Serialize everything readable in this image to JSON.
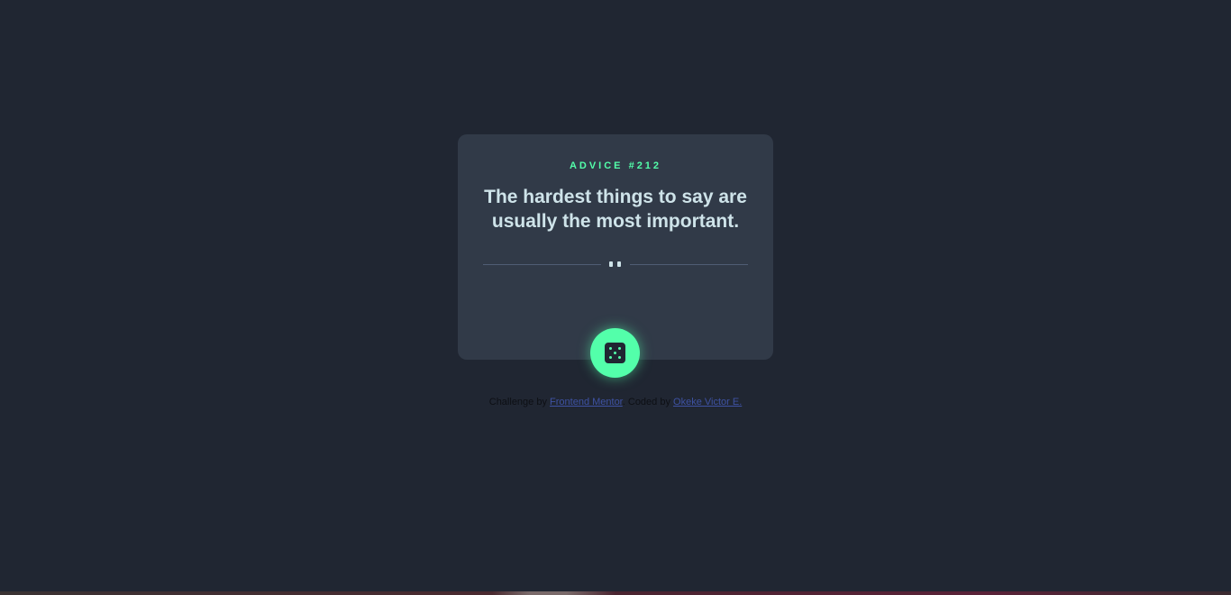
{
  "card": {
    "advice_label": "ADVICE #212",
    "advice_text": "The hardest things to say are usually the most important."
  },
  "divider": {
    "icon": "pause-icon"
  },
  "dice_button": {
    "icon": "dice-icon"
  },
  "attribution": {
    "challenge_prefix": "Challenge by",
    "challenge_link": "Frontend Mentor",
    "separator": ".",
    "coded_prefix": "Coded by",
    "coded_link": "Okeke Victor E."
  },
  "colors": {
    "background": "#202632",
    "card": "#313a48",
    "accent": "#53ffaa",
    "text": "#cee3e9",
    "divider": "#4f5d74",
    "link": "#3e52a3"
  }
}
